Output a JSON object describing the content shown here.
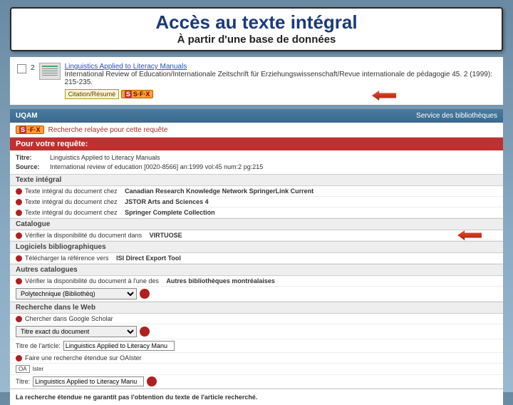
{
  "title": {
    "main": "Accès au texte intégral",
    "sub": "À partir d'une base de données"
  },
  "result": {
    "num": "2",
    "title": "Linguistics Applied to Literacy Manuals",
    "citation": "International Review of Education/Internationale Zeitschrift für Erziehungswissenschaft/Revue internationale de pédagogie 45. 2 (1999): 215-235.",
    "cite_btn": "Citation/Résumé",
    "sfx": "S·F·X"
  },
  "service": {
    "logo": "UQAM",
    "label": "Service des bibliothèques",
    "sfx_line": "Recherche relayée pour cette requête"
  },
  "request": {
    "header": "Pour votre requête:",
    "title_lbl": "Titre:",
    "title_val": "Linguistics Applied to Literacy Manuals",
    "source_lbl": "Source:",
    "source_val": "International review of education [0020-8566] an:1999 vol:45 num:2 pg:215"
  },
  "sections": {
    "fulltext": {
      "header": "Texte intégral",
      "rows": [
        {
          "prefix": "Texte intégral du document chez",
          "src": "Canadian Research Knowledge Network SpringerLink Current"
        },
        {
          "prefix": "Texte intégral du document chez",
          "src": "JSTOR Arts and Sciences 4"
        },
        {
          "prefix": "Texte intégral du document chez",
          "src": "Springer Complete Collection"
        }
      ]
    },
    "catalogue": {
      "header": "Catalogue",
      "row": {
        "prefix": "Vérifier la disponibilité du document dans",
        "src": "VIRTUOSE"
      }
    },
    "biblio": {
      "header": "Logiciels bibliographiques",
      "row": {
        "prefix": "Télécharger la référence vers",
        "src": "ISI Direct Export Tool"
      }
    },
    "other": {
      "header": "Autres catalogues",
      "row": {
        "prefix": "Vérifier la disponibilité du document à l'une des",
        "src": "Autres bibliothèques montréalaises"
      },
      "select_opts": [
        "Polytechnique (Bibliothèq)"
      ]
    },
    "web": {
      "header": "Recherche dans le Web",
      "row1": {
        "text": "Chercher dans Google Scholar"
      },
      "select_label": "Titre exact du document",
      "article_lbl": "Titre de l'article:",
      "article_val": "Linguistics Applied to Literacy Manu",
      "row2": {
        "text": "Faire une recherche étendue sur OAIster"
      },
      "oa": "OA",
      "title_lbl": "Titre:",
      "title_val": "Linguistics Applied to Literacy Manu"
    }
  },
  "disclaimer": "La recherche étendue ne garantit pas l'obtention du texte de l'article recherché."
}
